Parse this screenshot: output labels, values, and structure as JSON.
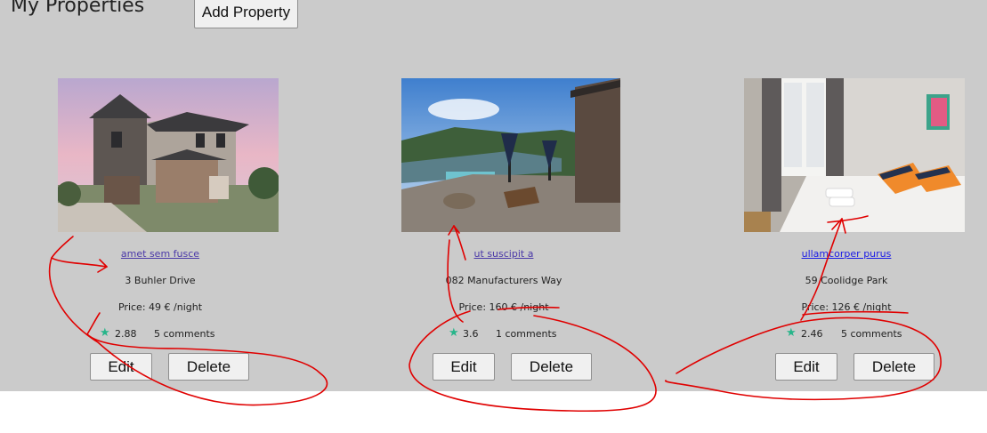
{
  "header": {
    "title": "My Properties",
    "add_button_label": "Add Property"
  },
  "properties": [
    {
      "name": "amet sem fusce",
      "address": "3 Buhler Drive",
      "price": "Price: 49 € /night",
      "rating": "2.88",
      "comments": "5 comments",
      "edit_label": "Edit",
      "delete_label": "Delete"
    },
    {
      "name": "ut suscipit a",
      "address": "082 Manufacturers Way",
      "price": "Price: 160 € /night",
      "rating": "3.6",
      "comments": "1 comments",
      "edit_label": "Edit",
      "delete_label": "Delete"
    },
    {
      "name": "ullamcorper purus",
      "address": "59 Coolidge Park",
      "price": "Price: 126 € /night",
      "rating": "2.46",
      "comments": "5 comments",
      "edit_label": "Edit",
      "delete_label": "Delete"
    }
  ],
  "colors": {
    "panel_bg": "#cbcbcb",
    "star": "#27b58a",
    "link_visited": "#4b39a8",
    "link": "#1a1ae6",
    "annotation": "#e00000"
  },
  "icons": [
    "star-icon"
  ]
}
